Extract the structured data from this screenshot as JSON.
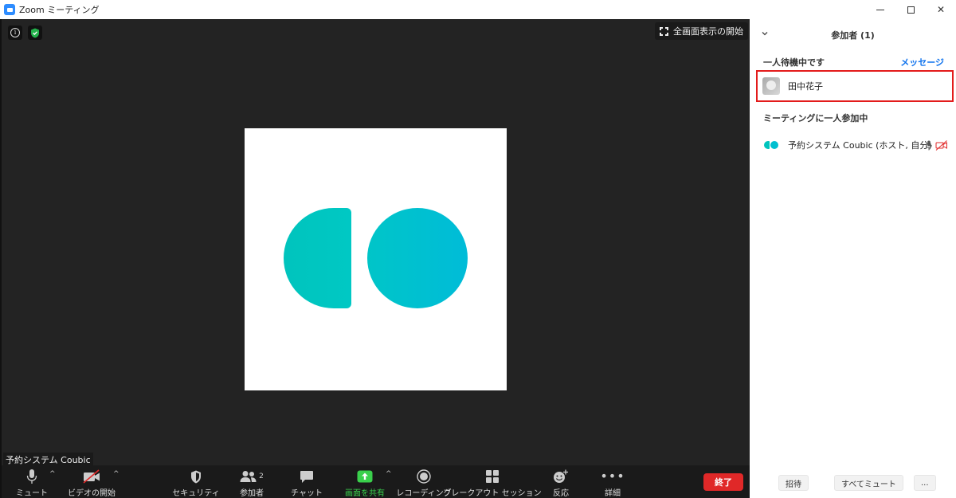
{
  "window": {
    "title": "Zoom ミーティング"
  },
  "video": {
    "fullscreen_label": "全画面表示の開始",
    "speaker_name": "予約システム Coubic"
  },
  "toolbar": {
    "mute_label": "ミュート",
    "video_label": "ビデオの開始",
    "security_label": "セキュリティ",
    "participants_label": "参加者",
    "participants_count": "2",
    "chat_label": "チャット",
    "share_label": "画面を共有",
    "record_label": "レコーディング",
    "breakout_label": "ブレークアウト セッション",
    "reactions_label": "反応",
    "more_label": "詳細",
    "end_label": "終了",
    "colors": {
      "bg": "#1a1a1a",
      "share_green": "#3ad04c",
      "end_red": "#e02828"
    }
  },
  "panel": {
    "title": "参加者 (1)",
    "waiting_title": "一人待機中です",
    "message_link": "メッセージ",
    "waiting_participant": "田中花子",
    "in_meeting_title": "ミーティングに一人参加中",
    "participant_name": "予約システム Coubic (ホスト, 自分)",
    "invite_label": "招待",
    "mute_all_label": "すべてミュート",
    "more_label": "...",
    "colors": {
      "highlight": "#e31b1b",
      "link": "#0e72ed"
    }
  }
}
